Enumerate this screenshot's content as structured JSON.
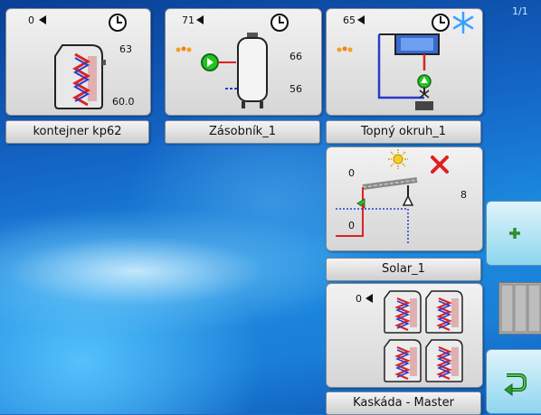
{
  "page_indicator": "1/1",
  "tiles": [
    {
      "id": "kontejner",
      "label": "kontejner kp62",
      "level": "0",
      "value_top": "63",
      "value_bottom": "60.0"
    },
    {
      "id": "zasobnik",
      "label": "Zásobník_1",
      "level": "71",
      "value_top": "66",
      "value_bottom": "56"
    },
    {
      "id": "topny_okruh",
      "label": "Topný okruh_1",
      "level": "65"
    },
    {
      "id": "solar",
      "label": "Solar_1",
      "value_top": "0",
      "value_right": "8",
      "value_bottom": "0"
    },
    {
      "id": "kaskada",
      "label": "Kaskáda - Master",
      "level": "0"
    }
  ],
  "sidebar": {
    "add_icon": "plus-icon",
    "grid_icon": "columns-icon",
    "back_icon": "return-arrow-icon"
  },
  "colors": {
    "add_icon": "#2e8f2e",
    "error_x": "#e02020",
    "snowflake": "#3aa0ff",
    "pump": "#22c422"
  }
}
